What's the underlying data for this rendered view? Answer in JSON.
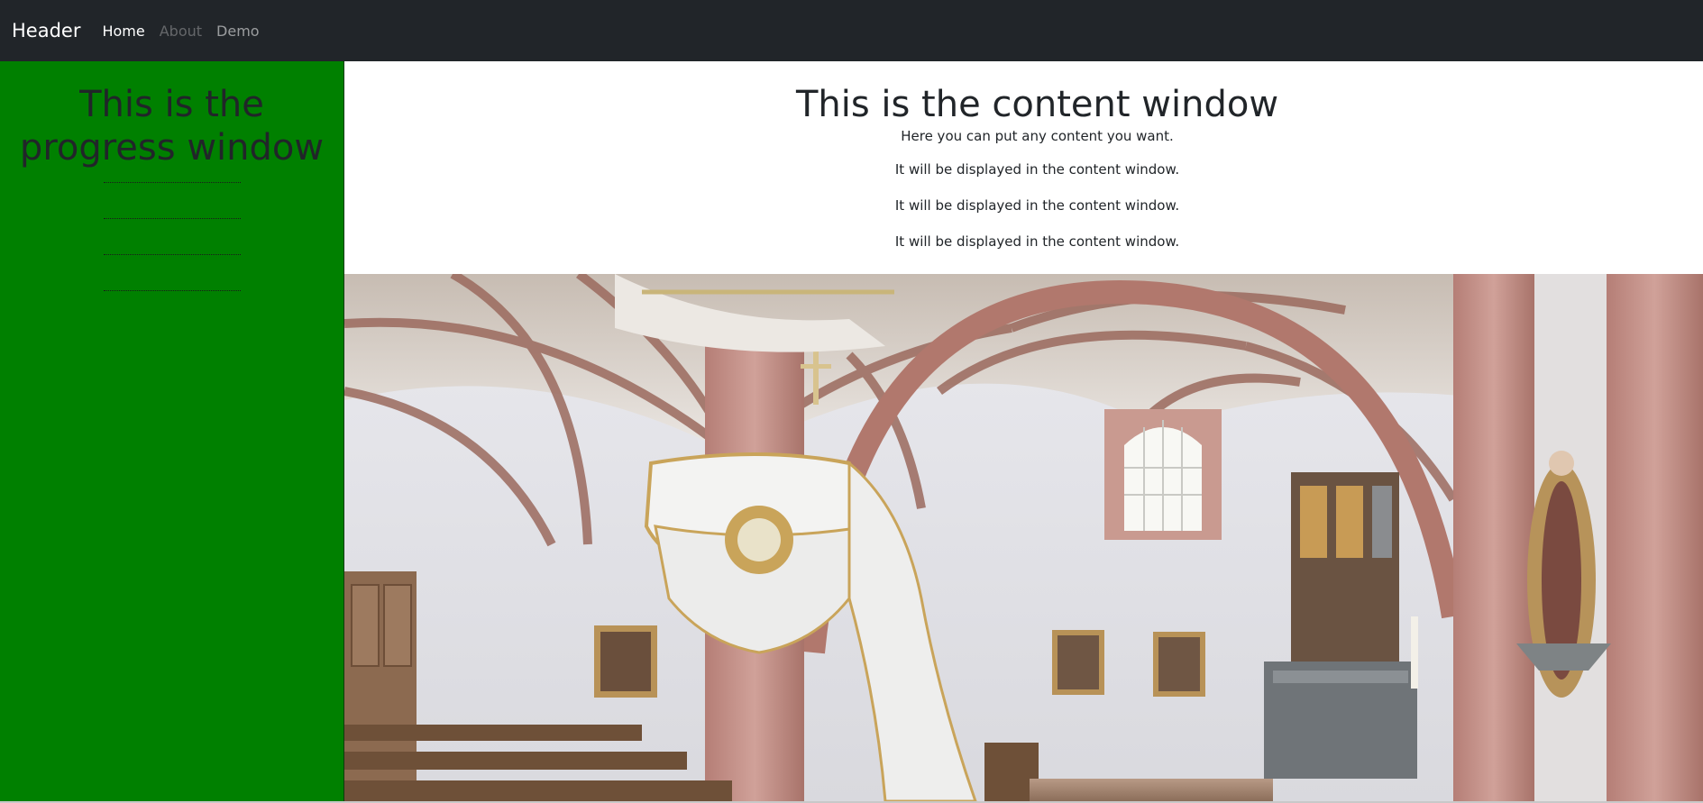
{
  "navbar": {
    "brand": "Header",
    "links": [
      {
        "label": "Home",
        "state": "active"
      },
      {
        "label": "About",
        "state": "disabled"
      },
      {
        "label": "Demo",
        "state": "normal"
      }
    ],
    "background_color": "#212529"
  },
  "progress_window": {
    "title": "This is the progress window",
    "background_color": "#008000",
    "steps": [
      "",
      "",
      "",
      ""
    ]
  },
  "content_window": {
    "title": "This is the content window",
    "paragraphs": [
      "Here you can put any content you want.",
      "It will be displayed in the content window.",
      "It will be displayed in the content window.",
      "It will be displayed in the content window."
    ],
    "image": {
      "subject": "church-interior-photo"
    }
  }
}
